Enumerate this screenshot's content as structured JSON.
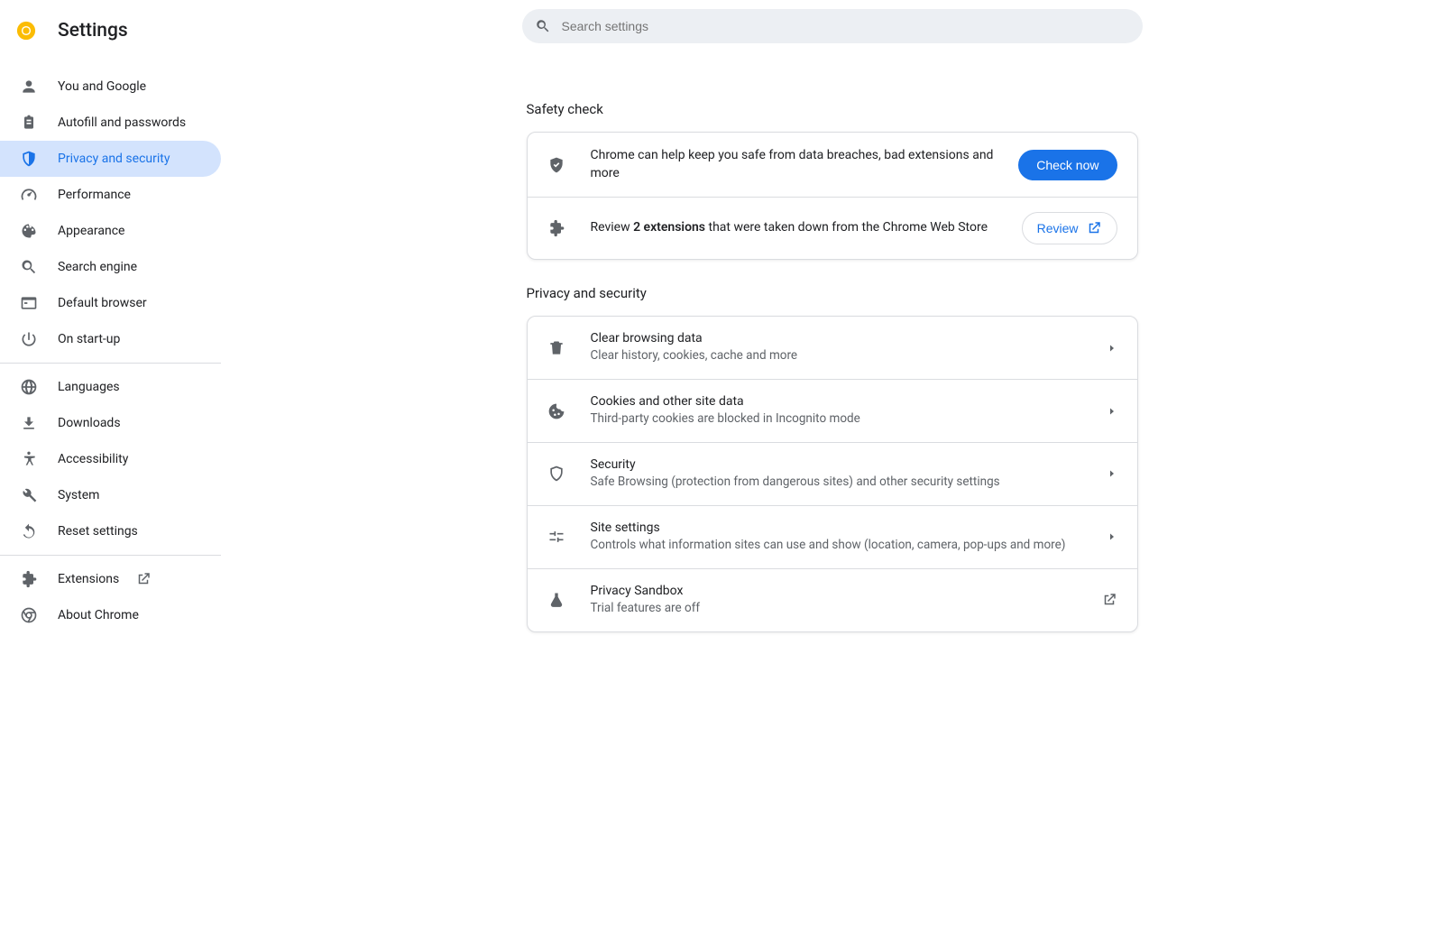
{
  "header": {
    "title": "Settings",
    "logo_name": "chrome-logo"
  },
  "search": {
    "placeholder": "Search settings",
    "value": ""
  },
  "sidebar": {
    "group1": [
      {
        "id": "you-and-google",
        "label": "You and Google",
        "icon": "person-icon"
      },
      {
        "id": "autofill",
        "label": "Autofill and passwords",
        "icon": "clipboard-icon"
      },
      {
        "id": "privacy",
        "label": "Privacy and security",
        "icon": "shield-icon",
        "active": true
      },
      {
        "id": "performance",
        "label": "Performance",
        "icon": "speedometer-icon"
      },
      {
        "id": "appearance",
        "label": "Appearance",
        "icon": "palette-icon"
      },
      {
        "id": "search-engine",
        "label": "Search engine",
        "icon": "search-icon"
      },
      {
        "id": "default-browser",
        "label": "Default browser",
        "icon": "browser-icon"
      },
      {
        "id": "on-start-up",
        "label": "On start-up",
        "icon": "power-icon"
      }
    ],
    "group2": [
      {
        "id": "languages",
        "label": "Languages",
        "icon": "globe-icon"
      },
      {
        "id": "downloads",
        "label": "Downloads",
        "icon": "download-icon"
      },
      {
        "id": "accessibility",
        "label": "Accessibility",
        "icon": "accessibility-icon"
      },
      {
        "id": "system",
        "label": "System",
        "icon": "wrench-icon"
      },
      {
        "id": "reset",
        "label": "Reset settings",
        "icon": "reset-icon"
      }
    ],
    "group3": [
      {
        "id": "extensions",
        "label": "Extensions",
        "icon": "extension-icon",
        "external": true
      },
      {
        "id": "about",
        "label": "About Chrome",
        "icon": "chrome-outline-icon"
      }
    ]
  },
  "sections": {
    "safety_check": {
      "title": "Safety check",
      "row1": {
        "text": "Chrome can help keep you safe from data breaches, bad extensions and more",
        "button": "Check now"
      },
      "row2": {
        "pre": "Review ",
        "bold": "2 extensions",
        "post": " that were taken down from the Chrome Web Store",
        "button": "Review"
      }
    },
    "privacy": {
      "title": "Privacy and security",
      "items": [
        {
          "title": "Clear browsing data",
          "sub": "Clear history, cookies, cache and more",
          "icon": "trash-icon",
          "action": "chevron"
        },
        {
          "title": "Cookies and other site data",
          "sub": "Third-party cookies are blocked in Incognito mode",
          "icon": "cookie-icon",
          "action": "chevron"
        },
        {
          "title": "Security",
          "sub": "Safe Browsing (protection from dangerous sites) and other security settings",
          "icon": "shield-outline-icon",
          "action": "chevron"
        },
        {
          "title": "Site settings",
          "sub": "Controls what information sites can use and show (location, camera, pop-ups and more)",
          "icon": "tune-icon",
          "action": "chevron"
        },
        {
          "title": "Privacy Sandbox",
          "sub": "Trial features are off",
          "icon": "flask-icon",
          "action": "open"
        }
      ]
    }
  }
}
